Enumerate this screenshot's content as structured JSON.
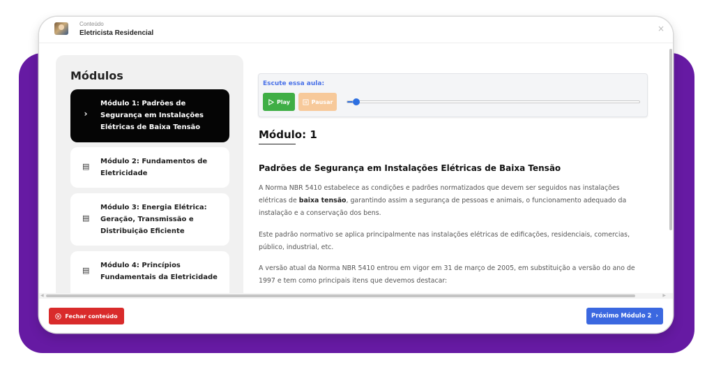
{
  "window": {
    "subtitle": "Conteúdo",
    "title": "Eletricista Residencial",
    "close_glyph": "×"
  },
  "sidebar": {
    "title": "Módulos",
    "items": [
      {
        "label": "Módulo 1: Padrões de Segurança em Instalações Elétricas de Baixa Tensão",
        "icon": "chevron-right-icon",
        "glyph": "›",
        "active": true
      },
      {
        "label": "Módulo 2: Fundamentos de Eletricidade",
        "icon": "document-icon",
        "glyph": "▤",
        "active": false
      },
      {
        "label": "Módulo 3: Energia Elétrica: Geração, Transmissão e Distribuição Eficiente",
        "icon": "document-icon",
        "glyph": "▤",
        "active": false
      },
      {
        "label": "Módulo 4: Princípios Fundamentais da Eletricidade",
        "icon": "document-icon",
        "glyph": "▤",
        "active": false
      }
    ]
  },
  "audio": {
    "label": "Escute essa aula:",
    "play_label": "Play",
    "pause_label": "Pausar",
    "progress": 0.02
  },
  "content": {
    "heading": "Módulo: 1",
    "subtitle": "Padrões de Segurança em Instalações Elétricas de Baixa Tensão",
    "p1_a": "A Norma NBR 5410 estabelece as condições e padrões normatizados que devem ser seguidos nas instalações elétricas de ",
    "p1_bold": "baixa tensão",
    "p1_b": ", garantindo assim a segurança de pessoas e animais, o funcionamento adequado da instalação e a conservação dos bens.",
    "p2": "Este padrão normativo se aplica principalmente nas instalações elétricas de edificações, residenciais, comercias, público, industrial, etc.",
    "p3": "A versão atual da Norma NBR 5410 entrou em vigor em 31 de março de 2005, em substituição a versão do ano de 1997 e tem como principais itens que devemos destacar:"
  },
  "footer": {
    "close_label": "Fechar conteúdo",
    "next_label": "Próximo Módulo 2"
  },
  "colors": {
    "purple": "#661aa3",
    "play_green": "#3fae45",
    "pause_orange": "#f7c99a",
    "close_red": "#d92b2b",
    "next_blue": "#3b68e0",
    "audio_label_blue": "#4a72e8"
  }
}
